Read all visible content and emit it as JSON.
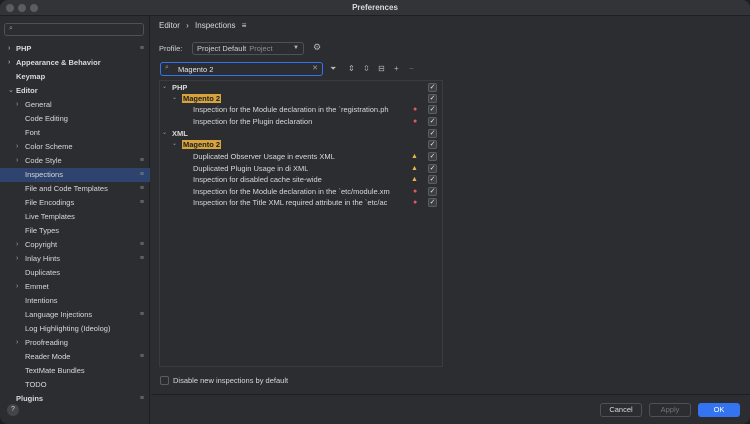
{
  "window": {
    "title": "Preferences"
  },
  "sidebar": {
    "items": [
      {
        "label": "PHP",
        "chevron": true,
        "pin": true
      },
      {
        "label": "Appearance & Behavior",
        "chevron": true,
        "pin": false
      },
      {
        "label": "Keymap",
        "chevron": false,
        "pin": false
      },
      {
        "label": "Editor",
        "chevron": true,
        "pin": false
      },
      {
        "label": "General",
        "chevron": true,
        "pin": false
      },
      {
        "label": "Code Editing",
        "chevron": false,
        "pin": false
      },
      {
        "label": "Font",
        "chevron": false,
        "pin": false
      },
      {
        "label": "Color Scheme",
        "chevron": true,
        "pin": false
      },
      {
        "label": "Code Style",
        "chevron": true,
        "pin": true
      },
      {
        "label": "Inspections",
        "chevron": false,
        "pin": true
      },
      {
        "label": "File and Code Templates",
        "chevron": false,
        "pin": true
      },
      {
        "label": "File Encodings",
        "chevron": false,
        "pin": true
      },
      {
        "label": "Live Templates",
        "chevron": false,
        "pin": false
      },
      {
        "label": "File Types",
        "chevron": false,
        "pin": false
      },
      {
        "label": "Copyright",
        "chevron": true,
        "pin": true
      },
      {
        "label": "Inlay Hints",
        "chevron": true,
        "pin": true
      },
      {
        "label": "Duplicates",
        "chevron": false,
        "pin": false
      },
      {
        "label": "Emmet",
        "chevron": true,
        "pin": false
      },
      {
        "label": "Intentions",
        "chevron": false,
        "pin": false
      },
      {
        "label": "Language Injections",
        "chevron": false,
        "pin": true
      },
      {
        "label": "Log Highlighting (Ideolog)",
        "chevron": false,
        "pin": false
      },
      {
        "label": "Proofreading",
        "chevron": true,
        "pin": false
      },
      {
        "label": "Reader Mode",
        "chevron": false,
        "pin": true
      },
      {
        "label": "TextMate Bundles",
        "chevron": false,
        "pin": false
      },
      {
        "label": "TODO",
        "chevron": false,
        "pin": false
      },
      {
        "label": "Plugins",
        "chevron": false,
        "pin": true
      }
    ],
    "search_icon": "search-icon",
    "help_label": "?"
  },
  "breadcrumb": {
    "root": "Editor",
    "separator": "›",
    "current": "Inspections",
    "menu_icon": "≡"
  },
  "profile": {
    "label": "Profile:",
    "value": "Project Default",
    "scope": "Project"
  },
  "filter": {
    "value": "Magento 2"
  },
  "tree": {
    "rows": [
      {
        "text": "PHP",
        "highlight": false,
        "chevron": "⌄",
        "severity": ""
      },
      {
        "text": "Magento 2",
        "highlight": true,
        "chevron": "⌄",
        "severity": ""
      },
      {
        "text": "Inspection for the Module declaration in the `registration.ph",
        "highlight": false,
        "chevron": "",
        "severity": "error"
      },
      {
        "text": "Inspection for the Plugin declaration",
        "highlight": false,
        "chevron": "",
        "severity": "error"
      },
      {
        "text": "XML",
        "highlight": false,
        "chevron": "⌄",
        "severity": ""
      },
      {
        "text": "Magento 2",
        "highlight": true,
        "chevron": "⌄",
        "severity": ""
      },
      {
        "text": "Duplicated Observer Usage in events XML",
        "highlight": false,
        "chevron": "",
        "severity": "warning"
      },
      {
        "text": "Duplicated Plugin Usage in di XML",
        "highlight": false,
        "chevron": "",
        "severity": "warning"
      },
      {
        "text": "Inspection for disabled cache site-wide",
        "highlight": false,
        "chevron": "",
        "severity": "warning"
      },
      {
        "text": "Inspection for the Module declaration in the `etc/module.xm",
        "highlight": false,
        "chevron": "",
        "severity": "error"
      },
      {
        "text": "Inspection for the Title XML required attribute in the `etc/ac",
        "highlight": false,
        "chevron": "",
        "severity": "error"
      }
    ]
  },
  "bottom": {
    "checkbox_label": "Disable new inspections by default"
  },
  "buttons": {
    "cancel": "Cancel",
    "apply": "Apply",
    "ok": "OK"
  },
  "colors": {
    "accent": "#3574f0",
    "selection": "#2e436e",
    "highlight": "#d7a33c",
    "error": "#e55765",
    "warning": "#e5b74a"
  }
}
